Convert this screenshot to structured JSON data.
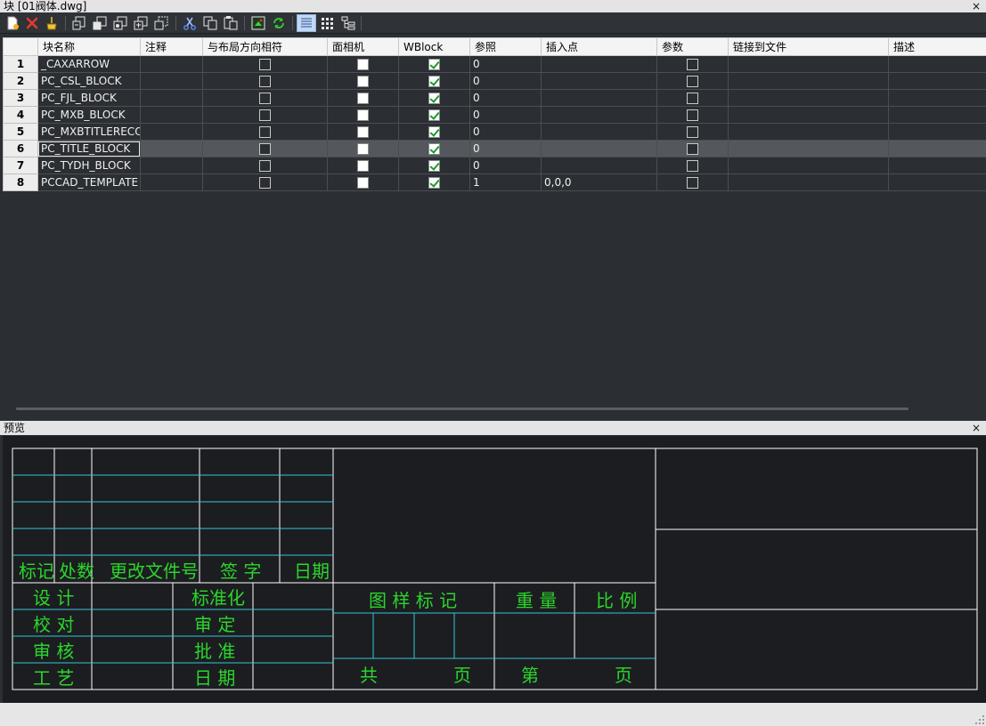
{
  "window": {
    "title": "块 [01阀体.dwg]",
    "close_glyph": "×"
  },
  "toolbar": {
    "buttons": [
      {
        "icon": "new-block-icon"
      },
      {
        "icon": "delete-icon"
      },
      {
        "icon": "purge-icon"
      },
      {
        "icon": "insert-block-icon"
      },
      {
        "icon": "redefine-block-icon"
      },
      {
        "icon": "edit-block-icon"
      },
      {
        "icon": "rename-block-icon"
      },
      {
        "icon": "extract-block-icon"
      },
      {
        "icon": "cut-icon"
      },
      {
        "icon": "copy-icon"
      },
      {
        "icon": "paste-icon"
      },
      {
        "icon": "export-icon"
      },
      {
        "icon": "refresh-icon"
      },
      {
        "icon": "details-view-icon"
      },
      {
        "icon": "thumbnail-view-icon"
      },
      {
        "icon": "tree-view-icon"
      }
    ]
  },
  "grid": {
    "columns": [
      "块名称",
      "注释",
      "与布局方向相符",
      "面相机",
      "WBlock",
      "参照",
      "插入点",
      "参数",
      "链接到文件",
      "描述"
    ],
    "rows": [
      {
        "num": "1",
        "name": "_CAXARROW",
        "ref": "0",
        "insert": ""
      },
      {
        "num": "2",
        "name": "PC_CSL_BLOCK",
        "ref": "0",
        "insert": ""
      },
      {
        "num": "3",
        "name": "PC_FJL_BLOCK",
        "ref": "0",
        "insert": ""
      },
      {
        "num": "4",
        "name": "PC_MXB_BLOCK",
        "ref": "0",
        "insert": ""
      },
      {
        "num": "5",
        "name": "PC_MXBTITLERECOF",
        "ref": "0",
        "insert": ""
      },
      {
        "num": "6",
        "name": "PC_TITLE_BLOCK",
        "ref": "0",
        "insert": ""
      },
      {
        "num": "7",
        "name": "PC_TYDH_BLOCK",
        "ref": "0",
        "insert": ""
      },
      {
        "num": "8",
        "name": "PCCAD_TEMPLATE",
        "ref": "1",
        "insert": "0,0,0"
      }
    ],
    "selected_row": "6"
  },
  "preview": {
    "title": "预览",
    "close_glyph": "×",
    "revision_headers": [
      "标记",
      "处数",
      "更改文件号",
      "签 字",
      "日期"
    ],
    "left_labels": [
      "设 计",
      "校 对",
      "审 核",
      "工 艺"
    ],
    "mid_labels": [
      "标准化",
      "审 定",
      "批 准",
      "日 期"
    ],
    "center_headers": [
      "图 样 标 记",
      "重 量",
      "比 例"
    ],
    "footer": [
      "共",
      "页",
      "第",
      "页"
    ],
    "colors": {
      "line_white": "#ffffff",
      "line_cyan": "#35c7d6",
      "text_green": "#2bd62b"
    }
  }
}
